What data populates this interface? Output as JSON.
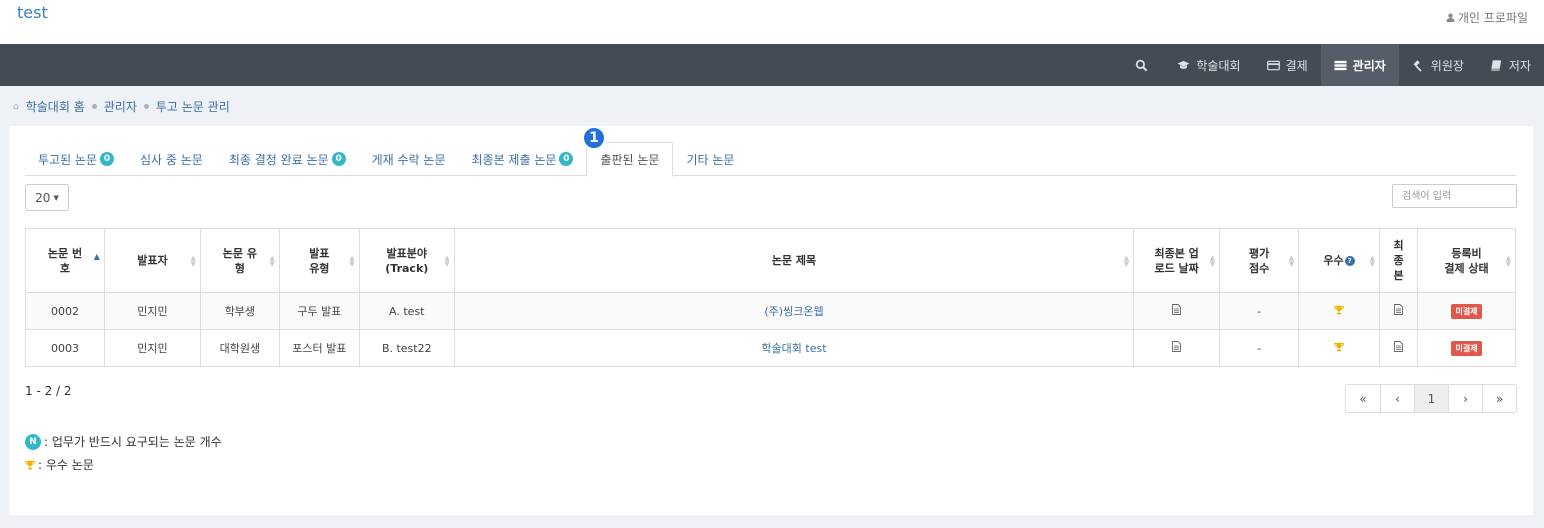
{
  "header": {
    "site_title": "test",
    "profile_label": "개인 프로파일"
  },
  "nav": {
    "items": [
      {
        "label": "학술대회",
        "icon": "graduation-cap-icon"
      },
      {
        "label": "결제",
        "icon": "credit-card-icon"
      },
      {
        "label": "관리자",
        "icon": "admin-list-icon",
        "active": true
      },
      {
        "label": "위원장",
        "icon": "gavel-icon"
      },
      {
        "label": "저자",
        "icon": "book-icon"
      }
    ]
  },
  "breadcrumb": [
    "학술대회 홈",
    "관리자",
    "투고 논문 관리"
  ],
  "tabs": [
    {
      "label": "투고된 논문",
      "badge": "0"
    },
    {
      "label": "심사 중 논문",
      "badge": ""
    },
    {
      "label": "최종 결정 완료 논문",
      "badge": "0"
    },
    {
      "label": "게재 수락 논문",
      "badge": ""
    },
    {
      "label": "최종본 제출 논문",
      "badge": "0"
    },
    {
      "label": "출판된 논문",
      "badge": "",
      "active": true
    },
    {
      "label": "기타 논문",
      "badge": ""
    }
  ],
  "step_marker": "1",
  "toolbar": {
    "page_size": "20",
    "search_placeholder": "검색어 입력"
  },
  "table": {
    "headers": {
      "paper_no": [
        "논문 번",
        "호"
      ],
      "presenter": [
        "발표자"
      ],
      "paper_type": [
        "논문 유",
        "형"
      ],
      "presentation_type": [
        "발표",
        "유형"
      ],
      "track": [
        "발표분야",
        "(Track)"
      ],
      "title": [
        "논문 제목"
      ],
      "final_upload_date": [
        "최종본 업",
        "로드 날짜"
      ],
      "score": [
        "평가",
        "점수"
      ],
      "excellent": [
        "우수"
      ],
      "final_version": [
        "최",
        "종",
        "본"
      ],
      "fee_status": [
        "등록비",
        "결제 상태"
      ]
    },
    "rows": [
      {
        "paper_no": "0002",
        "presenter": "민지민",
        "paper_type": "학부생",
        "presentation_type": "구두 발표",
        "track": "A. test",
        "title": "(주)씽크온웹",
        "score": "-",
        "fee_status": "미결제"
      },
      {
        "paper_no": "0003",
        "presenter": "민지민",
        "paper_type": "대학원생",
        "presentation_type": "포스터 발표",
        "track": "B. test22",
        "title": "학술대회 test",
        "score": "-",
        "fee_status": "미결제"
      }
    ]
  },
  "summary": "1 - 2 / 2",
  "pagination": [
    "«",
    "‹",
    "1",
    "›",
    "»"
  ],
  "legend": {
    "n_badge": "N",
    "n_text": ": 업무가 반드시 요구되는 논문 개수",
    "trophy_text": ": 우수 논문"
  },
  "colors": {
    "navbar": "#444b55",
    "accent": "#3a6fa8",
    "badge": "#34b7c8",
    "unpaid": "#e2574c",
    "trophy": "#f0b400"
  }
}
